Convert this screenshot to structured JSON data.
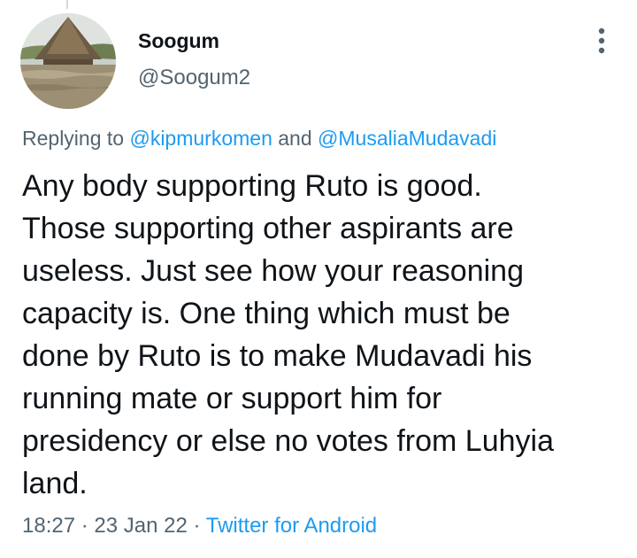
{
  "author": {
    "display_name": "Soogum",
    "handle": "@Soogum2",
    "avatar_icon": "flooded-thatched-hut-photo"
  },
  "reply": {
    "prefix": "Replying to",
    "mention_1": "@kipmurkomen",
    "joiner": "and",
    "mention_2": "@MusaliaMudavadi"
  },
  "tweet": {
    "lines": [
      "Any body supporting Ruto is good.",
      "Those supporting other aspirants are",
      "useless. Just see how your reasoning",
      "capacity is. One thing which must be",
      "done by Ruto is to make Mudavadi his",
      "running mate or support him for",
      "presidency or else no votes from Luhyia",
      "land."
    ]
  },
  "meta": {
    "time": "18:27",
    "separator": "·",
    "date": "23 Jan 22",
    "source": "Twitter for Android"
  },
  "icons": {
    "more": "more-vertical-icon"
  },
  "colors": {
    "link": "#1d9bf0",
    "secondary_text": "#536471",
    "primary_text": "#0f1419",
    "thread_line": "#cfd9de"
  }
}
